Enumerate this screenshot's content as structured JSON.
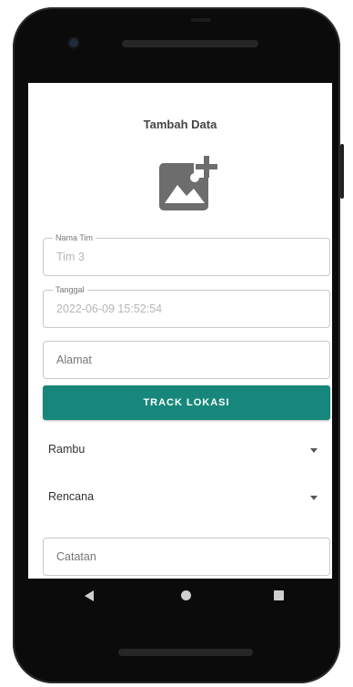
{
  "screen": {
    "title": "Tambah Data"
  },
  "form": {
    "nama_tim": {
      "label": "Nama Tim",
      "value": "Tim 3"
    },
    "tanggal": {
      "label": "Tanggal",
      "value": "2022-06-09 15:52:54"
    },
    "alamat": {
      "placeholder": "Alamat"
    },
    "track_button_label": "TRACK LOKASI",
    "rambu": {
      "selected": "Rambu"
    },
    "rencana": {
      "selected": "Rencana"
    },
    "catatan": {
      "placeholder": "Catatan"
    }
  },
  "icons": {
    "add_photo": "add-photo-icon",
    "dropdown": "caret-down-icon",
    "nav_back": "back-triangle-icon",
    "nav_home": "home-circle-icon",
    "nav_recent": "recent-square-icon"
  },
  "colors": {
    "accent": "#17877b",
    "phone_body": "#0b0b0b",
    "field_border": "#c9c9c9"
  }
}
